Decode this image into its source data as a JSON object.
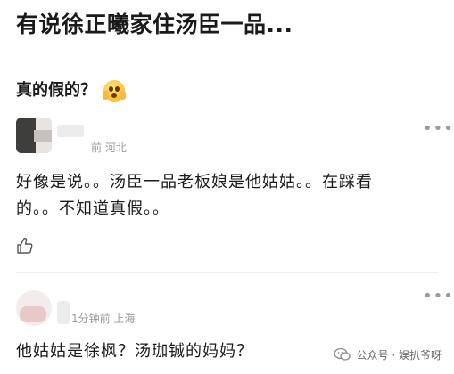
{
  "post": {
    "title": "有说徐正曦家住汤臣一品...",
    "question": "真的假的？"
  },
  "comments": [
    {
      "meta": "前 河北",
      "text_line1": "好像是说。。汤臣一品老板娘是他姑姑。。在踩看",
      "text_line2": "的。。不知道真假。。"
    },
    {
      "meta": "1分钟前 上海",
      "text": "他姑姑是徐枫？汤珈铖的妈妈？"
    }
  ],
  "icons": {
    "emoji": "shocked-face-emoji",
    "more": "more-dots-icon",
    "like": "thumbs-up-icon",
    "watermark_logo": "wechat-search-icon"
  },
  "watermark": {
    "text": "公众号 · 娱扒爷呀"
  },
  "colors": {
    "text": "#1a1a1a",
    "meta": "#9a9a9a",
    "background": "#ffffff"
  }
}
